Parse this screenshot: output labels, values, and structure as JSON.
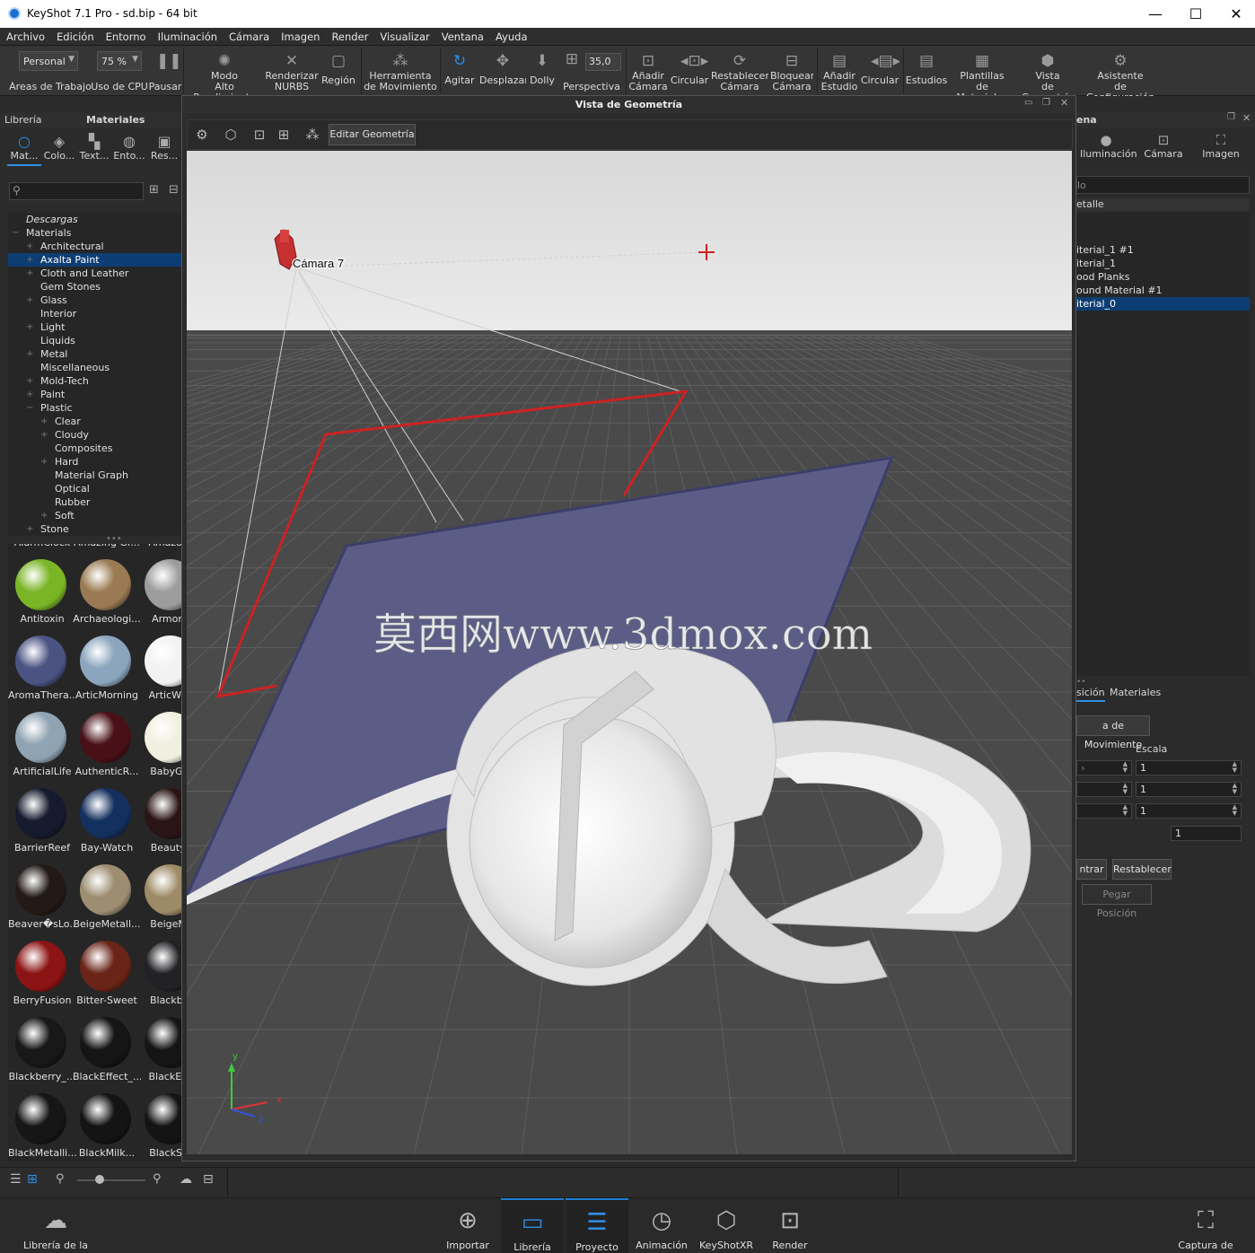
{
  "window": {
    "title": "KeyShot 7.1 Pro  - sd.bip  - 64 bit",
    "minimize": "—",
    "maximize": "☐",
    "close": "✕"
  },
  "menu": [
    "Archivo",
    "Edición",
    "Entorno",
    "Iluminación",
    "Cámara",
    "Imagen",
    "Render",
    "Visualizar",
    "Ventana",
    "Ayuda"
  ],
  "ribbon": {
    "workspace_value": "Personal",
    "workspace_label": "Áreas de Trabajo",
    "cpu_value": "75 %",
    "cpu_label": "Uso de CPU",
    "pause_label": "Pausar",
    "perf_label": "Modo\nAlto Rendimiento",
    "nurbs_label": "Renderizar\nNURBS",
    "region_label": "Región",
    "move_tool_label": "Herramienta\nde Movimiento",
    "tumble_label": "Agitar",
    "pan_label": "Desplazar",
    "dolly_label": "Dolly",
    "fov_value": "35,0",
    "perspective_label": "Perspectiva",
    "add_camera_label": "Añadir\nCámara",
    "cycle_camera_label": "Circular",
    "reset_camera_label": "Restablecer\nCámara",
    "lock_camera_label": "Bloquear\nCámara",
    "add_studio_label": "Añadir\nEstudio",
    "cycle_studio_label": "Circular",
    "studios_label": "Estudios",
    "templates_label": "Plantillas\nde Materiales",
    "geometry_view_label": "Vista\nde Geometría",
    "wizard_label": "Asistente\nde Configuración"
  },
  "left": {
    "tab_library": "Librería",
    "tab_title": "Materiales",
    "icons": [
      {
        "label": "Mat...",
        "icon": "search-globe"
      },
      {
        "label": "Colo...",
        "icon": "palette"
      },
      {
        "label": "Text...",
        "icon": "checker"
      },
      {
        "label": "Ento...",
        "icon": "globe"
      },
      {
        "label": "Res...",
        "icon": "image"
      }
    ],
    "tree": [
      {
        "label": "Descargas",
        "indent": 0,
        "italic": true
      },
      {
        "label": "Materials",
        "indent": 0,
        "exp": "−"
      },
      {
        "label": "Architectural",
        "indent": 1,
        "exp": "+"
      },
      {
        "label": "Axalta Paint",
        "indent": 1,
        "exp": "+",
        "selected": true
      },
      {
        "label": "Cloth and Leather",
        "indent": 1,
        "exp": "+"
      },
      {
        "label": "Gem Stones",
        "indent": 1
      },
      {
        "label": "Glass",
        "indent": 1,
        "exp": "+"
      },
      {
        "label": "Interior",
        "indent": 1
      },
      {
        "label": "Light",
        "indent": 1,
        "exp": "+"
      },
      {
        "label": "Liquids",
        "indent": 1
      },
      {
        "label": "Metal",
        "indent": 1,
        "exp": "+"
      },
      {
        "label": "Miscellaneous",
        "indent": 1
      },
      {
        "label": "Mold-Tech",
        "indent": 1,
        "exp": "+"
      },
      {
        "label": "Paint",
        "indent": 1,
        "exp": "+"
      },
      {
        "label": "Plastic",
        "indent": 1,
        "exp": "−"
      },
      {
        "label": "Clear",
        "indent": 2,
        "exp": "+"
      },
      {
        "label": "Cloudy",
        "indent": 2,
        "exp": "+"
      },
      {
        "label": "Composites",
        "indent": 2
      },
      {
        "label": "Hard",
        "indent": 2,
        "exp": "+"
      },
      {
        "label": "Material Graph",
        "indent": 2
      },
      {
        "label": "Optical",
        "indent": 2
      },
      {
        "label": "Rubber",
        "indent": 2
      },
      {
        "label": "Soft",
        "indent": 2,
        "exp": "+"
      },
      {
        "label": "Stone",
        "indent": 1,
        "exp": "+"
      }
    ],
    "thumbs": [
      {
        "label": "AlarmClock",
        "color": "none"
      },
      {
        "label": "Amazing Gr...",
        "color": "none"
      },
      {
        "label": "Amazon I",
        "color": "none"
      },
      {
        "label": "Antitoxin",
        "color": "#7ab526"
      },
      {
        "label": "Archaeologi...",
        "color": "#9a7a52"
      },
      {
        "label": "ArmorSi",
        "color": "#9c9c9c"
      },
      {
        "label": "AromaThera...",
        "color": "#4a5382"
      },
      {
        "label": "ArticMorning",
        "color": "#8aa5bd"
      },
      {
        "label": "ArticWhit",
        "color": "#f2f2f2"
      },
      {
        "label": "ArtificialLife",
        "color": "#8fa3b3"
      },
      {
        "label": "AuthenticR...",
        "color": "#4a1018"
      },
      {
        "label": "BabyGra",
        "color": "#f1efe0"
      },
      {
        "label": "BarrierReef",
        "color": "#161a2e"
      },
      {
        "label": "Bay-Watch",
        "color": "#13305e"
      },
      {
        "label": "BeautyC",
        "color": "#2a1416"
      },
      {
        "label": "Beaver�sLo...",
        "color": "#231a17"
      },
      {
        "label": "BeigeMetall...",
        "color": "#9d8e72"
      },
      {
        "label": "BeigeMe",
        "color": "#9d8a66"
      },
      {
        "label": "BerryFusion",
        "color": "#8c1414"
      },
      {
        "label": "Bitter-Sweet",
        "color": "#6a2518"
      },
      {
        "label": "Blackber",
        "color": "#222226"
      },
      {
        "label": "Blackberry_...",
        "color": "#181818"
      },
      {
        "label": "BlackEffect_...",
        "color": "#151515"
      },
      {
        "label": "BlackEffe",
        "color": "#151515"
      },
      {
        "label": "BlackMetalli...",
        "color": "#161616"
      },
      {
        "label": "BlackMilk...",
        "color": "#141414"
      },
      {
        "label": "BlackSoli",
        "color": "#141414"
      }
    ]
  },
  "viewport": {
    "window_title": "Vista de Geometría",
    "edit_button": "Editar Geometría",
    "camera_label": "Cámara 7",
    "watermark": "莫西网www.3dmox.com",
    "axis_y": "y",
    "axis_x": "x",
    "axis_z": "z"
  },
  "right": {
    "tab_title": "ena",
    "icons": [
      {
        "label": "Iluminación",
        "icon": "bulb"
      },
      {
        "label": "Cámara",
        "icon": "camera"
      },
      {
        "label": "Imagen",
        "icon": "frame"
      }
    ],
    "search_text": "lo",
    "list_header": "etalle",
    "items": [
      {
        "label": ""
      },
      {
        "label": ""
      },
      {
        "label": "iterial_1 #1"
      },
      {
        "label": "iterial_1"
      },
      {
        "label": "ood Planks"
      },
      {
        "label": "ound Material #1"
      },
      {
        "label": "iterial_0",
        "selected": true
      }
    ],
    "subtab_position": "sición",
    "subtab_materials": "Materiales",
    "move_tool_button": "a de Movimiento",
    "scale_label": "Escala",
    "spin_scale": [
      "1",
      "1",
      "1"
    ],
    "uniform_scale": "1",
    "center_button": "ntrar",
    "reset_button": "Restablecer",
    "paste_position": "Pegar Posición"
  },
  "bottom": [
    {
      "label": "Librería de la Nube",
      "icon": "cloud"
    },
    {
      "label": "Importar",
      "icon": "import"
    },
    {
      "label": "Librería",
      "icon": "book",
      "active": true
    },
    {
      "label": "Proyecto",
      "icon": "list",
      "active": true
    },
    {
      "label": "Animación",
      "icon": "play"
    },
    {
      "label": "KeyShotXR",
      "icon": "cube"
    },
    {
      "label": "Render",
      "icon": "render"
    },
    {
      "label": "Captura de pantalla",
      "icon": "screenshot"
    }
  ]
}
